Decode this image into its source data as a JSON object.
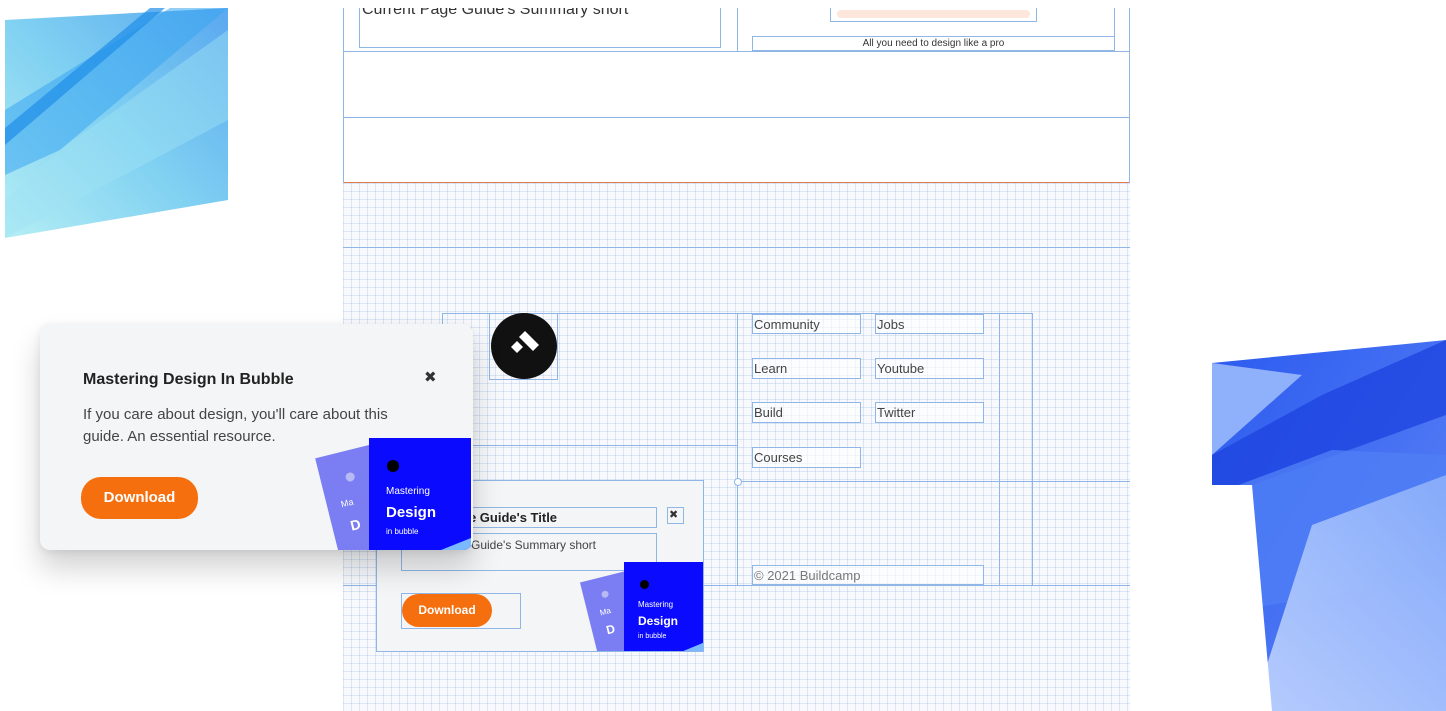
{
  "editor": {
    "top_left_text": "Current Page Guide's Summary short",
    "top_right_caption": "All you need to design like a pro",
    "nav_links": [
      "Community",
      "Jobs",
      "Learn",
      "Youtube",
      "Build",
      "Twitter",
      "Courses"
    ],
    "copyright": "© 2021 Buildcamp",
    "inner_popup": {
      "title": "ge Guide's Title",
      "summary": "e Guide's Summary short",
      "button": "Download",
      "close": "✖"
    }
  },
  "popup": {
    "title": "Mastering Design In Bubble",
    "body": "If you care about design, you'll care about this guide. An essential resource.",
    "button": "Download",
    "close": "✖"
  },
  "book": {
    "line1": "Mastering",
    "line2": "Design",
    "line3": "in bubble",
    "back_fragment": "Ma",
    "back_letter": "D"
  },
  "colors": {
    "accent": "#f56f0e",
    "book_blue": "#0a0aff",
    "book_back": "#7b7ef2",
    "grid_line": "#8fb6e6",
    "orange_divider": "#e07a4e"
  }
}
